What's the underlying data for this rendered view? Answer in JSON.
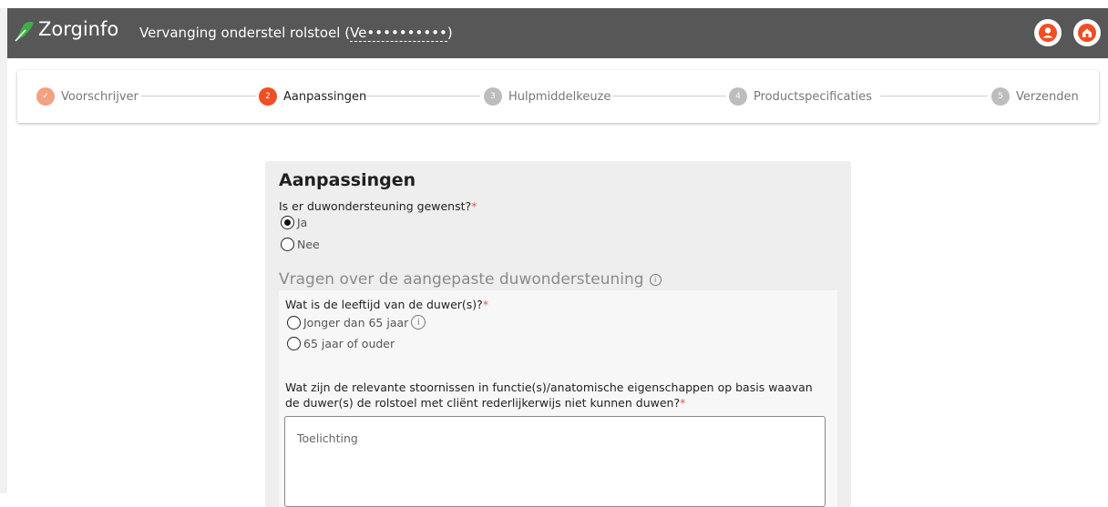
{
  "header": {
    "brand": "Zorginfo",
    "title": "Vervanging onderstel rolstoel (",
    "title_ref": "Ve••••••••••",
    "title_close": ")",
    "accent": "#f04e23",
    "logo_color": "#3fae49",
    "user_icon": "user-circle-icon",
    "home_icon": "home-icon"
  },
  "steps": [
    {
      "number": "✓",
      "label": "Voorschrijver",
      "state": "done"
    },
    {
      "number": "2",
      "label": "Aanpassingen",
      "state": "active"
    },
    {
      "number": "3",
      "label": "Hulpmiddelkeuze",
      "state": "todo"
    },
    {
      "number": "4",
      "label": "Productspecificaties",
      "state": "todo"
    },
    {
      "number": "5",
      "label": "Verzenden",
      "state": "todo"
    }
  ],
  "form": {
    "title": "Aanpassingen",
    "q1": {
      "label": "Is er duwondersteuning gewenst?",
      "required": "*",
      "options": [
        "Ja",
        "Nee"
      ],
      "selected": "Ja"
    },
    "section_title": "Vragen over de aangepaste duwondersteuning",
    "q2": {
      "label": "Wat is de leeftijd van de duwer(s)?",
      "required": "*",
      "options": [
        "Jonger dan 65 jaar",
        "65 jaar of ouder"
      ]
    },
    "q3": {
      "label_line1": "Wat zijn de relevante stoornissen in functie(s)/anatomische eigenschappen op basis waavan",
      "label_line2": "de duwer(s) de rolstoel met cliënt rederlijkerwijs niet kunnen duwen?",
      "required": "*",
      "placeholder": "Toelichting"
    }
  }
}
